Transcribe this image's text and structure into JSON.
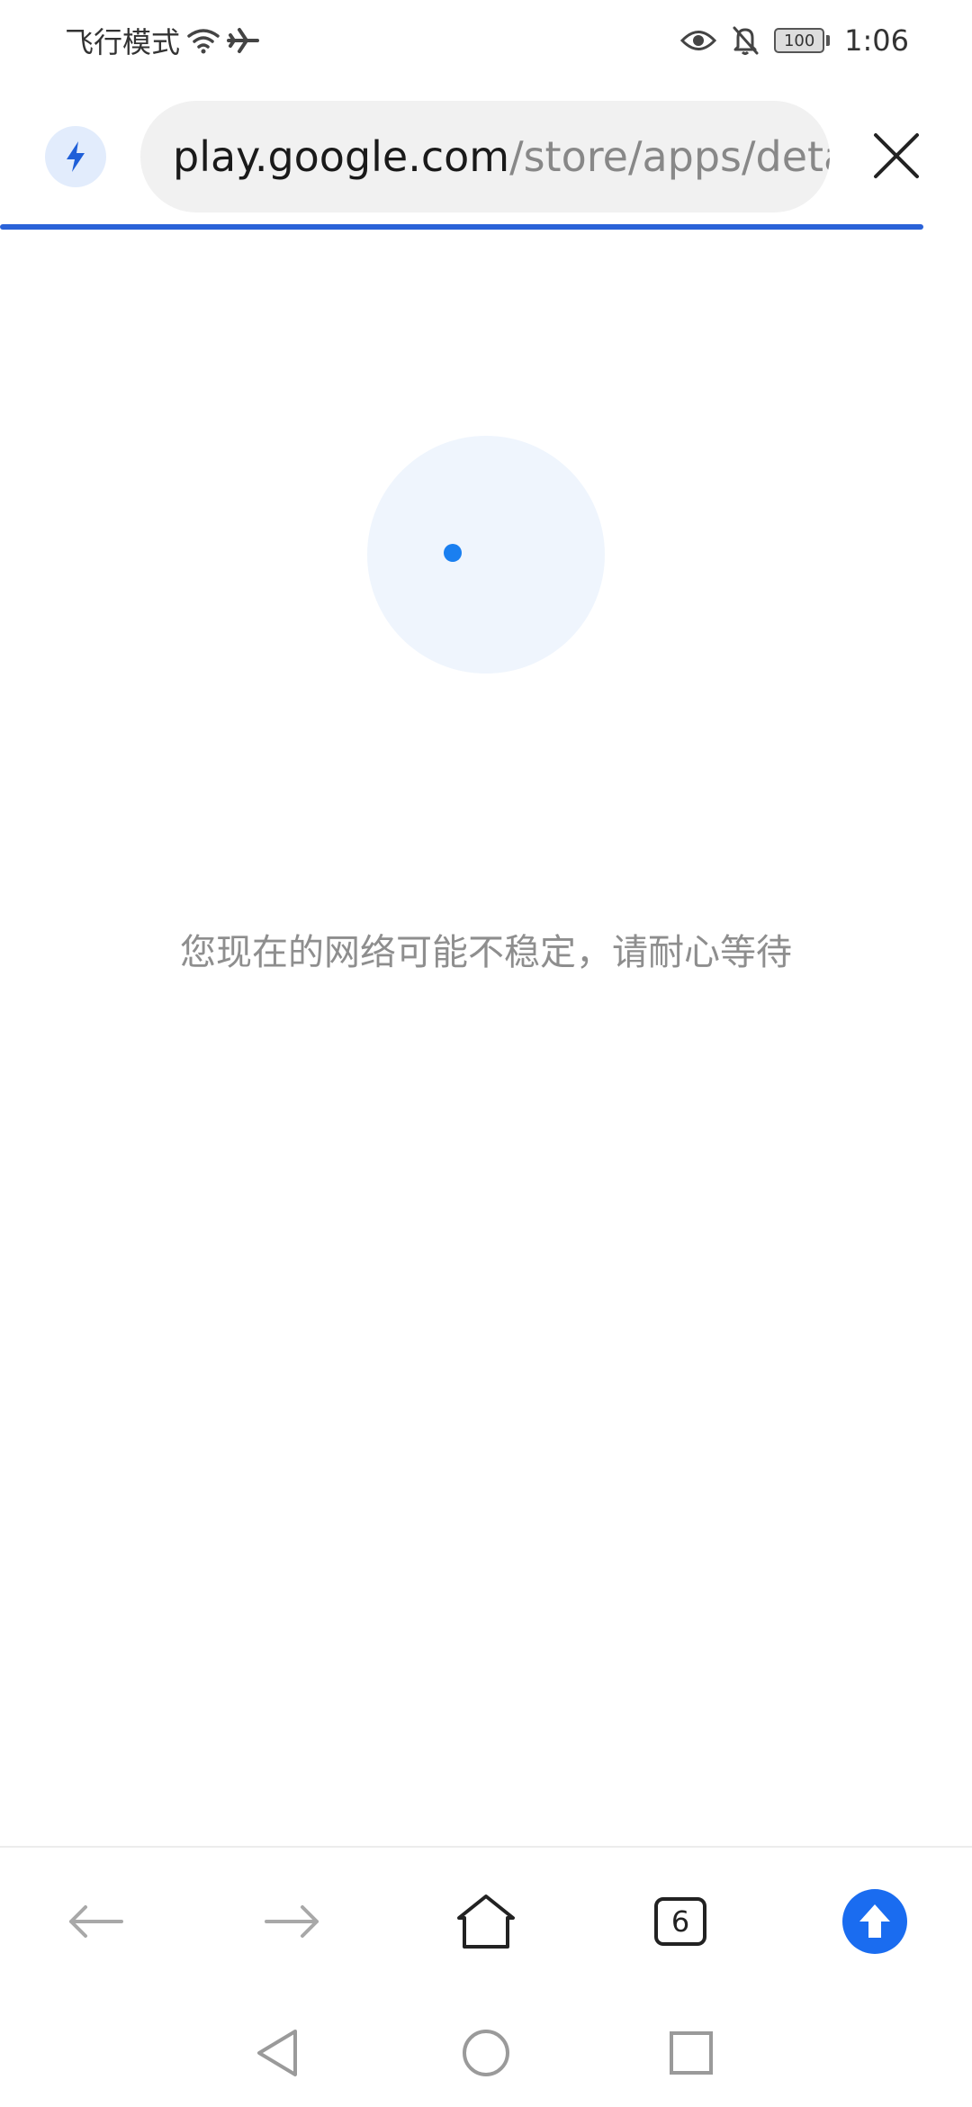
{
  "status_bar": {
    "left_text": "飞行模式",
    "battery_level": "100",
    "time": "1:06",
    "icons": [
      "wifi-icon",
      "airplane-icon",
      "eye-icon",
      "bell-off-icon",
      "battery-icon"
    ]
  },
  "address_bar": {
    "url_host": "play.google.com",
    "url_path": "/store/apps/deta",
    "left_icon": "lightning-bolt-icon",
    "right_icon": "close-icon",
    "progress_color": "#2a62d8"
  },
  "content": {
    "message": "您现在的网络可能不稳定，请耐心等待",
    "loader_color": "#1a7ff0"
  },
  "toolbar": {
    "tab_count": "6",
    "items": [
      "back-icon",
      "forward-icon",
      "home-icon",
      "tabs-icon",
      "upgrade-icon"
    ],
    "accent": "#1a6cf0"
  },
  "system_nav": {
    "items": [
      "nav-back-icon",
      "nav-home-icon",
      "nav-recents-icon"
    ]
  }
}
